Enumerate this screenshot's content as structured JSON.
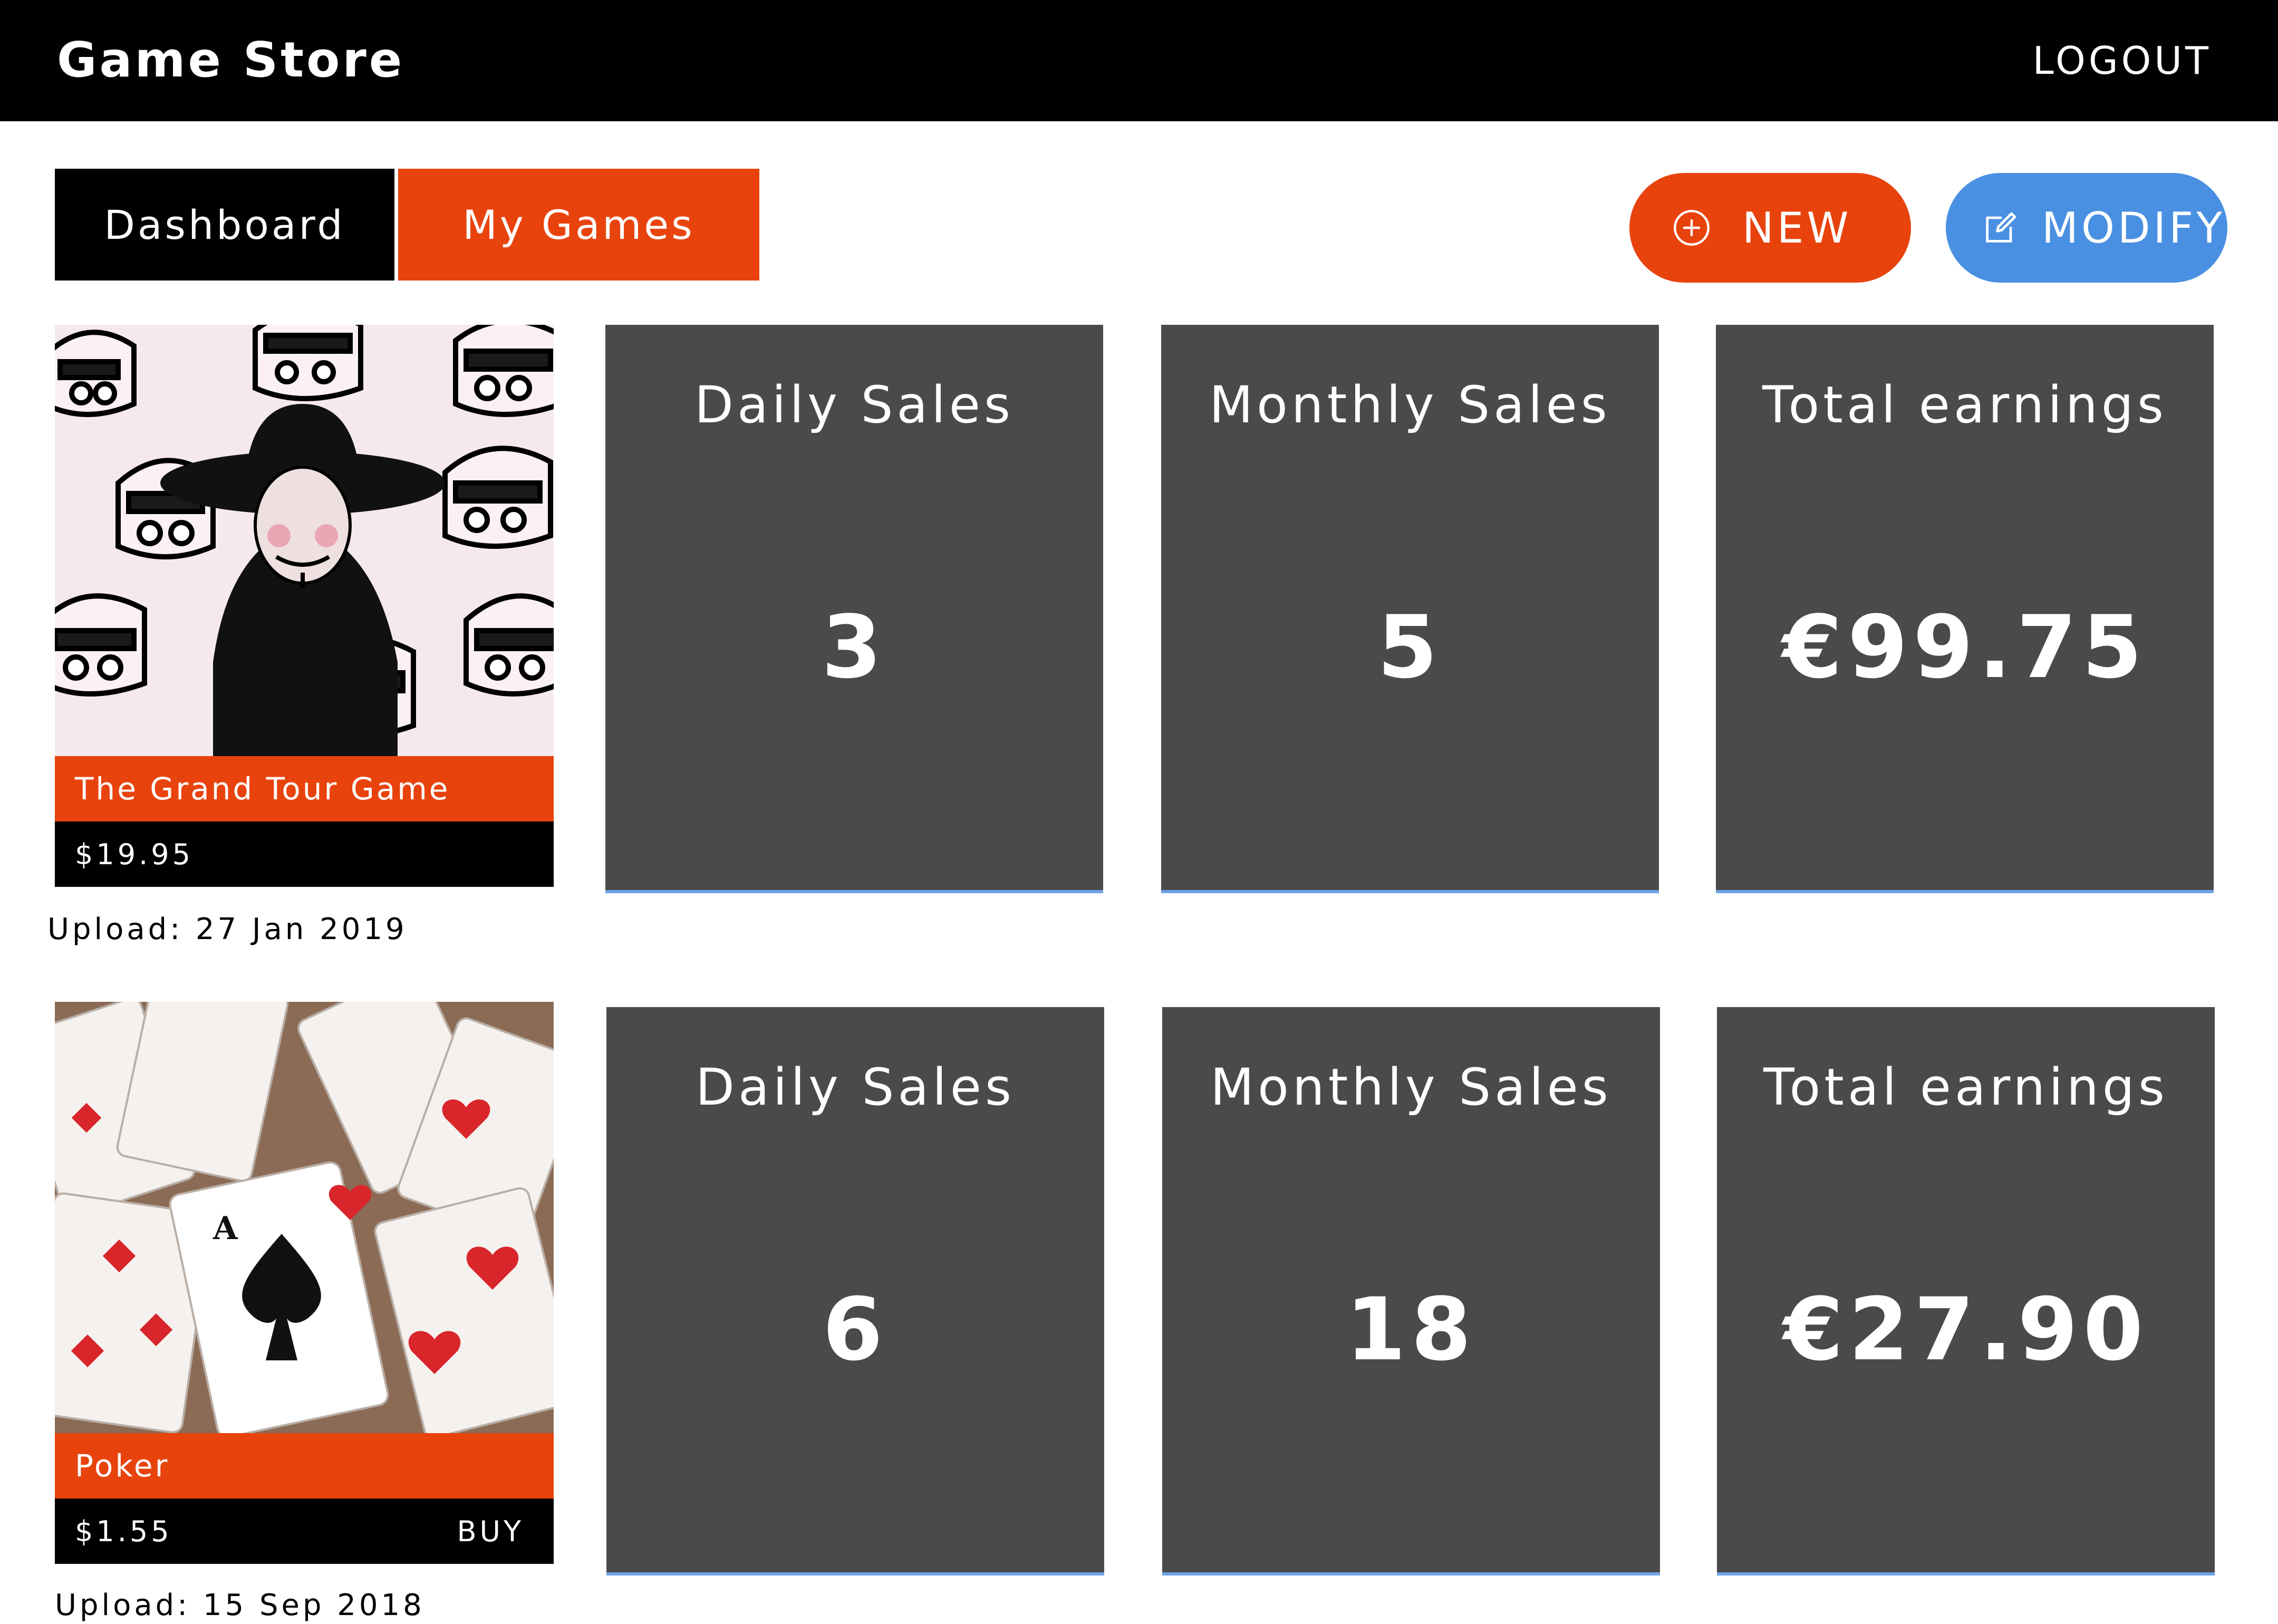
{
  "header": {
    "title": "Game Store",
    "logout_label": "LOGOUT"
  },
  "tabs": [
    {
      "label": "Dashboard",
      "active": false
    },
    {
      "label": "My Games",
      "active": true
    }
  ],
  "actions": {
    "new_label": "NEW",
    "new_icon": "plus-circle-icon",
    "modify_label": "MODIFY",
    "modify_icon": "edit-icon"
  },
  "colors": {
    "accent": "#e8430d",
    "dark": "#000000",
    "tile": "#4a4a4a",
    "modify": "#4a90e2"
  },
  "games": [
    {
      "name": "The Grand Tour Game",
      "price": "$19.95",
      "action_label": "",
      "upload": "Upload: 27 Jan 2019",
      "artwork": "stormtroopers-mural",
      "stats": [
        {
          "label": "Daily Sales",
          "value": "3"
        },
        {
          "label": "Monthly Sales",
          "value": "5"
        },
        {
          "label": "Total earnings",
          "value": "€99.75"
        }
      ]
    },
    {
      "name": "Poker",
      "price": "$1.55",
      "action_label": "BUY",
      "upload": "Upload: 15 Sep 2018",
      "artwork": "playing-cards",
      "stats": [
        {
          "label": "Daily Sales",
          "value": "6"
        },
        {
          "label": "Monthly Sales",
          "value": "18"
        },
        {
          "label": "Total earnings",
          "value": "€27.90"
        }
      ]
    }
  ]
}
